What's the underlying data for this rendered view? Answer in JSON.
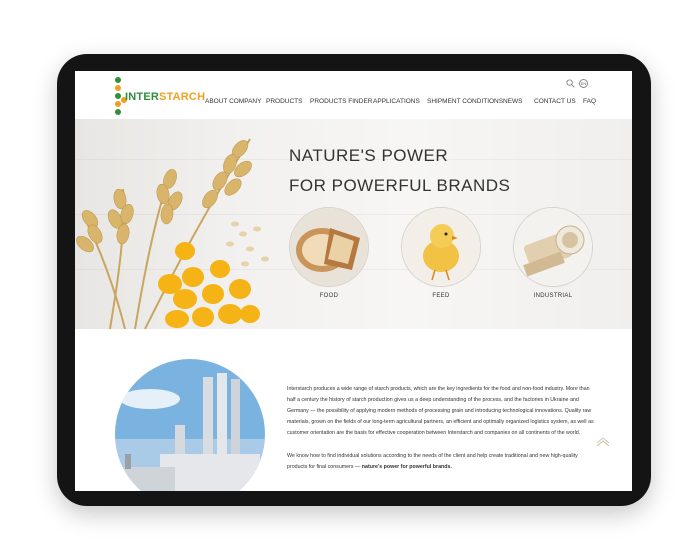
{
  "brand": {
    "logo_first": "INTER",
    "logo_rest": "STARCH",
    "dot_colors": [
      "#2f8f3a",
      "#f0a020",
      "#2f8f3a",
      "#f0a020",
      "#2f8f3a",
      "#f0a020"
    ]
  },
  "nav": {
    "items": [
      "ABOUT COMPANY",
      "PRODUCTS",
      "PRODUCTS FINDER",
      "APPLICATIONS",
      "SHIPMENT CONDITIONS",
      "NEWS",
      "CONTACT US",
      "FAQ"
    ],
    "lang_label": "EN"
  },
  "hero": {
    "line1": "NATURE'S POWER",
    "line2": "FOR POWERFUL BRANDS",
    "categories": [
      "FOOD",
      "FEED",
      "INDUSTRIAL"
    ]
  },
  "content": {
    "paragraph1": "Interstarch produces a wide range of starch products, which are the key ingredients for the food and non-food industry. More than half a century the history of starch production gives us a deep understanding of the process, and the factories in Ukraine and Germany — the possibility of applying modern methods of processing grain and introducing technological innovations. Quality raw materials, grown on the fields of our long-term agricultural partners, an efficient and optimally organized logistics system, as well as customer orientation are the basis for effective cooperation between Interstarch and companies on all continents of the world.",
    "paragraph2_start": "We know how to find individual solutions according to the needs of the client and help create traditional and new high-quality products for final consumers — ",
    "paragraph2_bold": "nature's power for powerful brands."
  },
  "colors": {
    "green": "#2f8f3a",
    "orange": "#f0a020",
    "text": "#333333"
  }
}
